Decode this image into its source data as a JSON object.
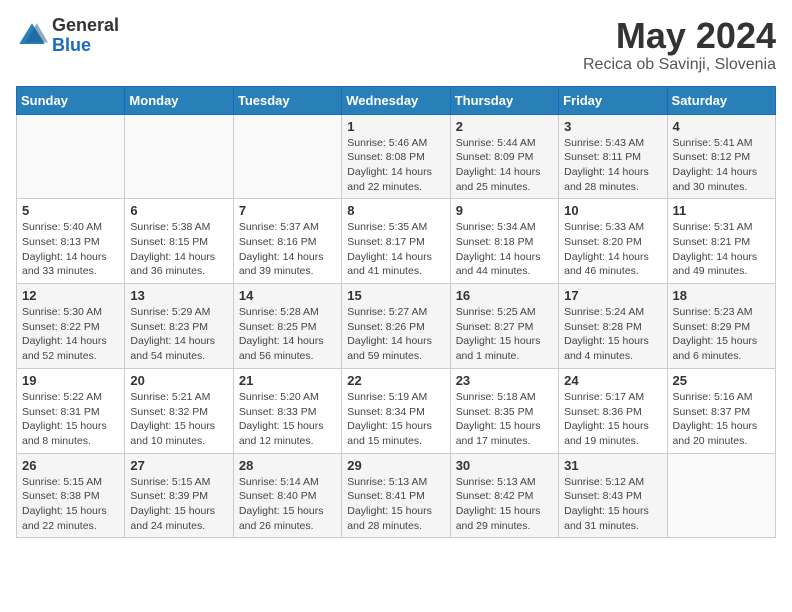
{
  "header": {
    "logo": {
      "general": "General",
      "blue": "Blue"
    },
    "title": "May 2024",
    "location": "Recica ob Savinji, Slovenia"
  },
  "weekdays": [
    "Sunday",
    "Monday",
    "Tuesday",
    "Wednesday",
    "Thursday",
    "Friday",
    "Saturday"
  ],
  "weeks": [
    [
      {
        "day": "",
        "info": ""
      },
      {
        "day": "",
        "info": ""
      },
      {
        "day": "",
        "info": ""
      },
      {
        "day": "1",
        "info": "Sunrise: 5:46 AM\nSunset: 8:08 PM\nDaylight: 14 hours\nand 22 minutes."
      },
      {
        "day": "2",
        "info": "Sunrise: 5:44 AM\nSunset: 8:09 PM\nDaylight: 14 hours\nand 25 minutes."
      },
      {
        "day": "3",
        "info": "Sunrise: 5:43 AM\nSunset: 8:11 PM\nDaylight: 14 hours\nand 28 minutes."
      },
      {
        "day": "4",
        "info": "Sunrise: 5:41 AM\nSunset: 8:12 PM\nDaylight: 14 hours\nand 30 minutes."
      }
    ],
    [
      {
        "day": "5",
        "info": "Sunrise: 5:40 AM\nSunset: 8:13 PM\nDaylight: 14 hours\nand 33 minutes."
      },
      {
        "day": "6",
        "info": "Sunrise: 5:38 AM\nSunset: 8:15 PM\nDaylight: 14 hours\nand 36 minutes."
      },
      {
        "day": "7",
        "info": "Sunrise: 5:37 AM\nSunset: 8:16 PM\nDaylight: 14 hours\nand 39 minutes."
      },
      {
        "day": "8",
        "info": "Sunrise: 5:35 AM\nSunset: 8:17 PM\nDaylight: 14 hours\nand 41 minutes."
      },
      {
        "day": "9",
        "info": "Sunrise: 5:34 AM\nSunset: 8:18 PM\nDaylight: 14 hours\nand 44 minutes."
      },
      {
        "day": "10",
        "info": "Sunrise: 5:33 AM\nSunset: 8:20 PM\nDaylight: 14 hours\nand 46 minutes."
      },
      {
        "day": "11",
        "info": "Sunrise: 5:31 AM\nSunset: 8:21 PM\nDaylight: 14 hours\nand 49 minutes."
      }
    ],
    [
      {
        "day": "12",
        "info": "Sunrise: 5:30 AM\nSunset: 8:22 PM\nDaylight: 14 hours\nand 52 minutes."
      },
      {
        "day": "13",
        "info": "Sunrise: 5:29 AM\nSunset: 8:23 PM\nDaylight: 14 hours\nand 54 minutes."
      },
      {
        "day": "14",
        "info": "Sunrise: 5:28 AM\nSunset: 8:25 PM\nDaylight: 14 hours\nand 56 minutes."
      },
      {
        "day": "15",
        "info": "Sunrise: 5:27 AM\nSunset: 8:26 PM\nDaylight: 14 hours\nand 59 minutes."
      },
      {
        "day": "16",
        "info": "Sunrise: 5:25 AM\nSunset: 8:27 PM\nDaylight: 15 hours\nand 1 minute."
      },
      {
        "day": "17",
        "info": "Sunrise: 5:24 AM\nSunset: 8:28 PM\nDaylight: 15 hours\nand 4 minutes."
      },
      {
        "day": "18",
        "info": "Sunrise: 5:23 AM\nSunset: 8:29 PM\nDaylight: 15 hours\nand 6 minutes."
      }
    ],
    [
      {
        "day": "19",
        "info": "Sunrise: 5:22 AM\nSunset: 8:31 PM\nDaylight: 15 hours\nand 8 minutes."
      },
      {
        "day": "20",
        "info": "Sunrise: 5:21 AM\nSunset: 8:32 PM\nDaylight: 15 hours\nand 10 minutes."
      },
      {
        "day": "21",
        "info": "Sunrise: 5:20 AM\nSunset: 8:33 PM\nDaylight: 15 hours\nand 12 minutes."
      },
      {
        "day": "22",
        "info": "Sunrise: 5:19 AM\nSunset: 8:34 PM\nDaylight: 15 hours\nand 15 minutes."
      },
      {
        "day": "23",
        "info": "Sunrise: 5:18 AM\nSunset: 8:35 PM\nDaylight: 15 hours\nand 17 minutes."
      },
      {
        "day": "24",
        "info": "Sunrise: 5:17 AM\nSunset: 8:36 PM\nDaylight: 15 hours\nand 19 minutes."
      },
      {
        "day": "25",
        "info": "Sunrise: 5:16 AM\nSunset: 8:37 PM\nDaylight: 15 hours\nand 20 minutes."
      }
    ],
    [
      {
        "day": "26",
        "info": "Sunrise: 5:15 AM\nSunset: 8:38 PM\nDaylight: 15 hours\nand 22 minutes."
      },
      {
        "day": "27",
        "info": "Sunrise: 5:15 AM\nSunset: 8:39 PM\nDaylight: 15 hours\nand 24 minutes."
      },
      {
        "day": "28",
        "info": "Sunrise: 5:14 AM\nSunset: 8:40 PM\nDaylight: 15 hours\nand 26 minutes."
      },
      {
        "day": "29",
        "info": "Sunrise: 5:13 AM\nSunset: 8:41 PM\nDaylight: 15 hours\nand 28 minutes."
      },
      {
        "day": "30",
        "info": "Sunrise: 5:13 AM\nSunset: 8:42 PM\nDaylight: 15 hours\nand 29 minutes."
      },
      {
        "day": "31",
        "info": "Sunrise: 5:12 AM\nSunset: 8:43 PM\nDaylight: 15 hours\nand 31 minutes."
      },
      {
        "day": "",
        "info": ""
      }
    ]
  ]
}
